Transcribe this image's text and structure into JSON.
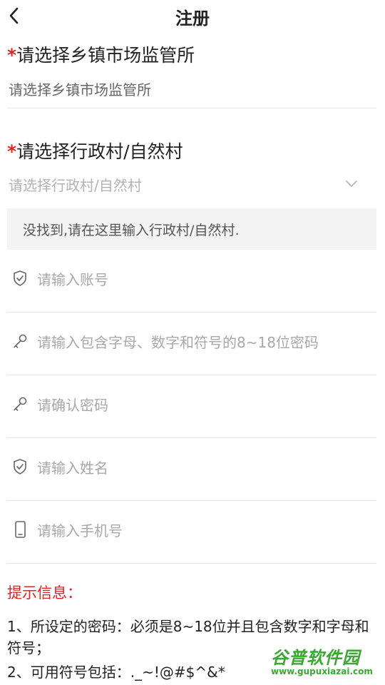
{
  "header": {
    "title": "注册",
    "back_icon": "back-arrow-icon"
  },
  "township": {
    "required_mark": "*",
    "label": "请选择乡镇市场监管所",
    "value": "请选择乡镇市场监管所"
  },
  "village": {
    "required_mark": "*",
    "label": "请选择行政村/自然村",
    "placeholder": "请选择行政村/自然村",
    "dropdown_icon": "chevron-down-icon"
  },
  "manual_village": {
    "text": "没找到,请在这里输入行政村/自然村."
  },
  "fields": {
    "account": {
      "placeholder": "请输入账号",
      "icon": "shield-check-icon"
    },
    "password": {
      "placeholder": "请输入包含字母、数字和符号的8~18位密码",
      "icon": "key-icon"
    },
    "confirm_password": {
      "placeholder": "请确认密码",
      "icon": "key-icon"
    },
    "name": {
      "placeholder": "请输入姓名",
      "icon": "shield-check-icon"
    },
    "phone": {
      "placeholder": "请输入手机号",
      "icon": "phone-icon"
    }
  },
  "tips": {
    "title": "提示信息：",
    "items": [
      "1、所设定的密码：必须是8~18位并且包含数字和字母和符号；",
      "2、可用符号包括：._~!@#$^&*"
    ]
  },
  "watermark": {
    "brand": "谷普软件园",
    "url": "www.gupuxiazai.com"
  },
  "colors": {
    "required": "#e02424",
    "tips_title": "#e02424",
    "hint_bg": "#f3f3f3",
    "watermark": "#3aa832"
  }
}
